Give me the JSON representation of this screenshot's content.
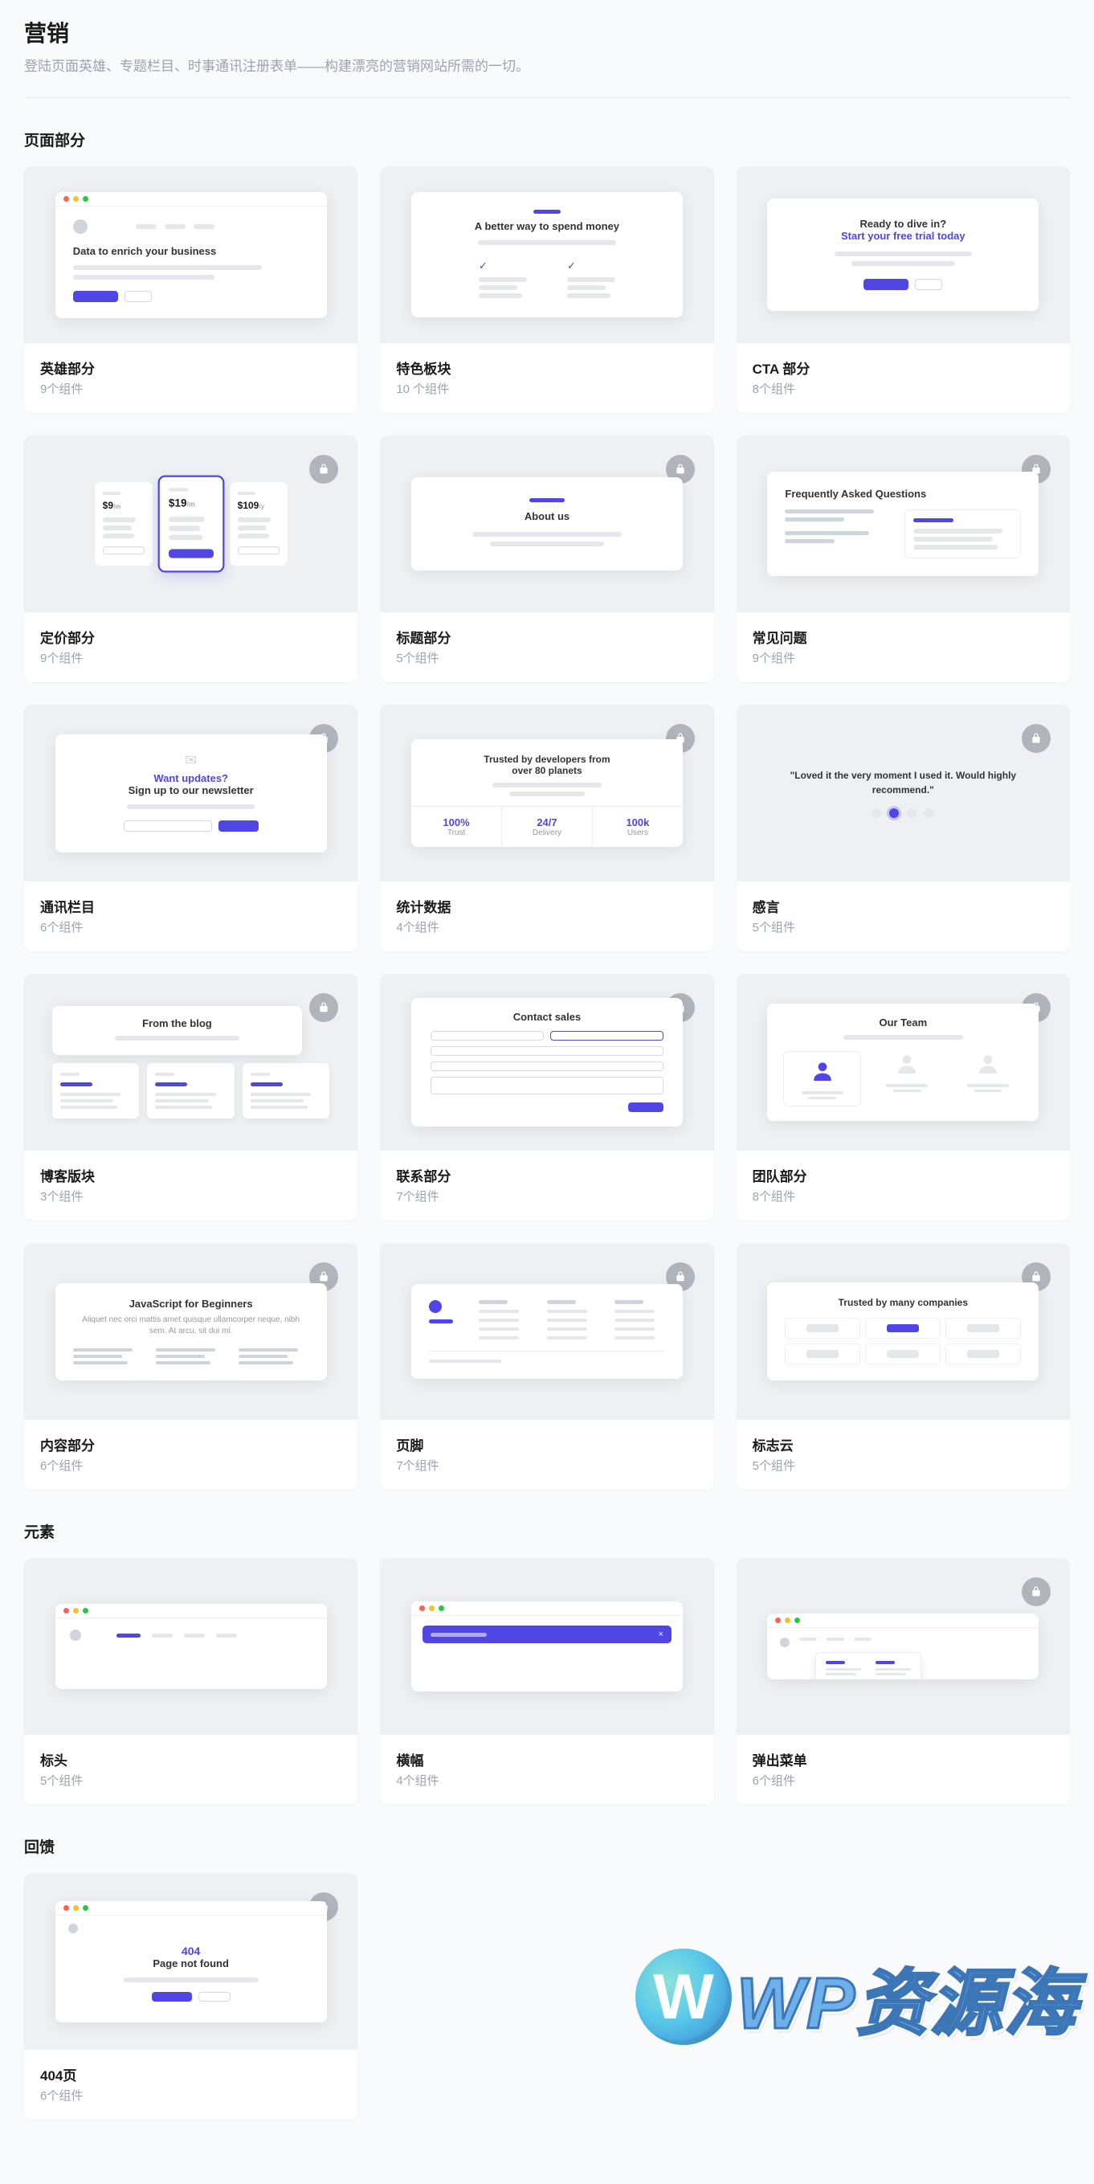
{
  "header": {
    "title": "营销",
    "description": "登陆页面英雄、专题栏目、时事通讯注册表单——构建漂亮的营销网站所需的一切。"
  },
  "sections": [
    {
      "title": "页面部分",
      "items": [
        {
          "id": "hero",
          "title": "英雄部分",
          "sub": "9个组件",
          "preview": "hero",
          "locked": false
        },
        {
          "id": "feature",
          "title": "特色板块",
          "sub": "10 个组件",
          "preview": "feature",
          "locked": false
        },
        {
          "id": "cta",
          "title": "CTA 部分",
          "sub": "8个组件",
          "preview": "cta",
          "locked": false
        },
        {
          "id": "pricing",
          "title": "定价部分",
          "sub": "9个组件",
          "preview": "pricing",
          "locked": true
        },
        {
          "id": "heading",
          "title": "标题部分",
          "sub": "5个组件",
          "preview": "heading",
          "locked": true
        },
        {
          "id": "faq",
          "title": "常见问题",
          "sub": "9个组件",
          "preview": "faq",
          "locked": true
        },
        {
          "id": "newsletter",
          "title": "通讯栏目",
          "sub": "6个组件",
          "preview": "newsletter",
          "locked": true
        },
        {
          "id": "stats",
          "title": "统计数据",
          "sub": "4个组件",
          "preview": "stats",
          "locked": true
        },
        {
          "id": "testi",
          "title": "感言",
          "sub": "5个组件",
          "preview": "testimonial",
          "locked": true
        },
        {
          "id": "blog",
          "title": "博客版块",
          "sub": "3个组件",
          "preview": "blog",
          "locked": true
        },
        {
          "id": "contact",
          "title": "联系部分",
          "sub": "7个组件",
          "preview": "contact",
          "locked": true
        },
        {
          "id": "team",
          "title": "团队部分",
          "sub": "8个组件",
          "preview": "team",
          "locked": true
        },
        {
          "id": "content",
          "title": "内容部分",
          "sub": "6个组件",
          "preview": "content",
          "locked": true
        },
        {
          "id": "footer",
          "title": "页脚",
          "sub": "7个组件",
          "preview": "footer",
          "locked": true
        },
        {
          "id": "logocloud",
          "title": "标志云",
          "sub": "5个组件",
          "preview": "logocloud",
          "locked": true
        }
      ]
    },
    {
      "title": "元素",
      "items": [
        {
          "id": "header",
          "title": "标头",
          "sub": "5个组件",
          "preview": "header",
          "locked": false
        },
        {
          "id": "banner",
          "title": "横幅",
          "sub": "4个组件",
          "preview": "banner",
          "locked": false
        },
        {
          "id": "flyout",
          "title": "弹出菜单",
          "sub": "6个组件",
          "preview": "flyout",
          "locked": true
        }
      ]
    },
    {
      "title": "回馈",
      "items": [
        {
          "id": "p404",
          "title": "404页",
          "sub": "6个组件",
          "preview": "p404",
          "locked": true
        }
      ]
    }
  ],
  "preview_strings": {
    "hero": "Data to enrich your business",
    "feature": "A better way to spend money",
    "cta_line1": "Ready to dive in?",
    "cta_line2": "Start your free trial today",
    "pricing": {
      "p1": "$9/m",
      "p2": "$19/m",
      "p3": "$109/y"
    },
    "heading": "About us",
    "faq": "Frequently Asked Questions",
    "newsletter_l1": "Want updates?",
    "newsletter_l2": "Sign up to our newsletter",
    "stats_title_l1": "Trusted by developers from",
    "stats_title_l2": "over 80 planets",
    "stats": [
      {
        "v": "100%",
        "l": "Trust"
      },
      {
        "v": "24/7",
        "l": "Delivery"
      },
      {
        "v": "100k",
        "l": "Users"
      }
    ],
    "testimonial": "\"Loved it the very moment I used it. Would highly recommend.\"",
    "blog": "From the blog",
    "contact": "Contact sales",
    "team": "Our Team",
    "content_title": "JavaScript for Beginners",
    "content_body": "Aliquet nec orci mattis amet quisque ullamcorper neque, nibh sem. At arcu, sit dui mi.",
    "logocloud": "Trusted by many companies",
    "p404_code": "404",
    "p404_msg": "Page not found"
  },
  "watermark": "WP资源海"
}
